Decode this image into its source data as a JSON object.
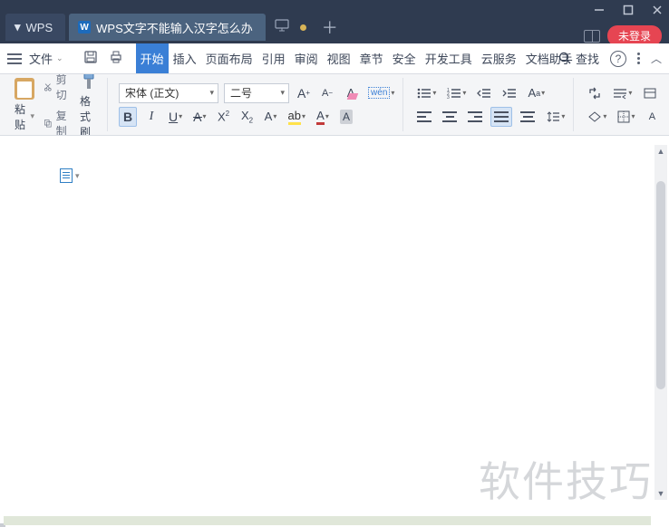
{
  "titlebar": {
    "app_name": "WPS",
    "doc_tab": "WPS文字不能输入汉字怎么办",
    "login_label": "未登录"
  },
  "menu": {
    "file_label": "文件",
    "tabs": [
      "开始",
      "插入",
      "页面布局",
      "引用",
      "审阅",
      "视图",
      "章节",
      "安全",
      "开发工具",
      "云服务",
      "文档助手"
    ],
    "active_tab_index": 0,
    "search_label": "查找"
  },
  "ribbon": {
    "paste_label": "粘贴",
    "cut_label": "剪切",
    "copy_label": "复制",
    "format_painter_label": "格式刷",
    "font_name": "宋体 (正文)",
    "font_size": "二号",
    "wen_label": "wén"
  },
  "watermark": "软件技巧"
}
